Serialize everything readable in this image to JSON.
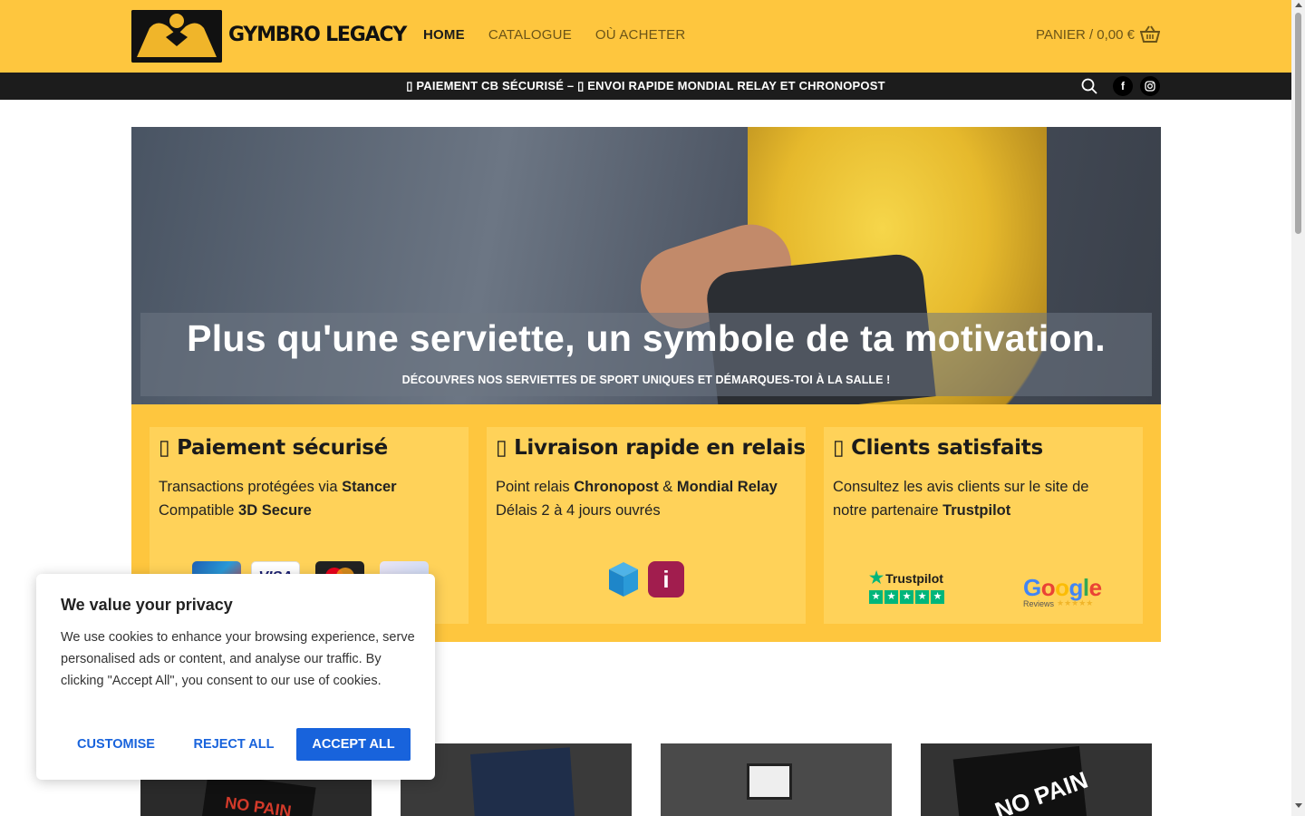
{
  "header": {
    "brand": "GYMBRO LEGACY",
    "nav": [
      {
        "label": "HOME",
        "active": true
      },
      {
        "label": "CATALOGUE",
        "active": false
      },
      {
        "label": "OÙ ACHETER",
        "active": false
      }
    ],
    "cart_label": "PANIER / 0,00 €",
    "cart_icon": "basket-icon",
    "logo_icon": "arm-wrestling-logo"
  },
  "topbar": {
    "text": "▯ PAIEMENT CB SÉCURISÉ – ▯ ENVOI RAPIDE MONDIAL RELAY ET CHRONOPOST",
    "search_icon": "search-icon",
    "facebook_label": "f",
    "instagram_icon": "instagram-icon"
  },
  "hero": {
    "title": "Plus qu'une serviette, un symbole de ta motivation.",
    "subtitle": "DÉCOUVRES NOS SERVIETTES DE SPORT UNIQUES ET DÉMARQUES-TOI À LA SALLE !"
  },
  "features": [
    {
      "title": "▯ Paiement sécurisé",
      "line1_pre": "Transactions protégées via ",
      "line1_bold": "Stancer",
      "line2_pre": "Compatible ",
      "line2_bold": "3D Secure",
      "icons": [
        "cb-card-icon",
        "visa-card-icon",
        "mastercard-icon",
        "card-icon"
      ]
    },
    {
      "title": "▯ Livraison rapide en relais",
      "line1_pre": "Point relais ",
      "line1_bold": "Chronopost",
      "line1_mid": " & ",
      "line1_bold2": "Mondial Relay",
      "line2_pre": "Délais 2 à 4 jours ouvrés",
      "relay_i": "i",
      "icons": [
        "chronopost-box-icon",
        "mondial-relay-icon"
      ]
    },
    {
      "title": "▯ Clients satisfaits",
      "line1_pre": "Consultez les avis clients sur le site de",
      "line2_pre": "notre partenaire ",
      "line2_bold": "Trustpilot",
      "trustpilot": "Trustpilot",
      "google": "Google",
      "google_sub": "Reviews",
      "google_stars": "★★★★★"
    }
  ],
  "products": [
    {
      "text": "NO PAIN"
    },
    {
      "text": ""
    },
    {
      "text": ""
    },
    {
      "text": "NO PAIN"
    }
  ],
  "cookie": {
    "title": "We value your privacy",
    "text": "We use cookies to enhance your browsing experience, serve personalised ads or content, and analyse our traffic. By clicking \"Accept All\", you consent to our use of cookies.",
    "customise": "CUSTOMISE",
    "reject": "REJECT ALL",
    "accept": "ACCEPT ALL"
  },
  "colors": {
    "brand_yellow": "#fec63e",
    "card_yellow": "#ffd259",
    "topbar": "#1c1c1c",
    "accept_blue": "#1863dc"
  }
}
